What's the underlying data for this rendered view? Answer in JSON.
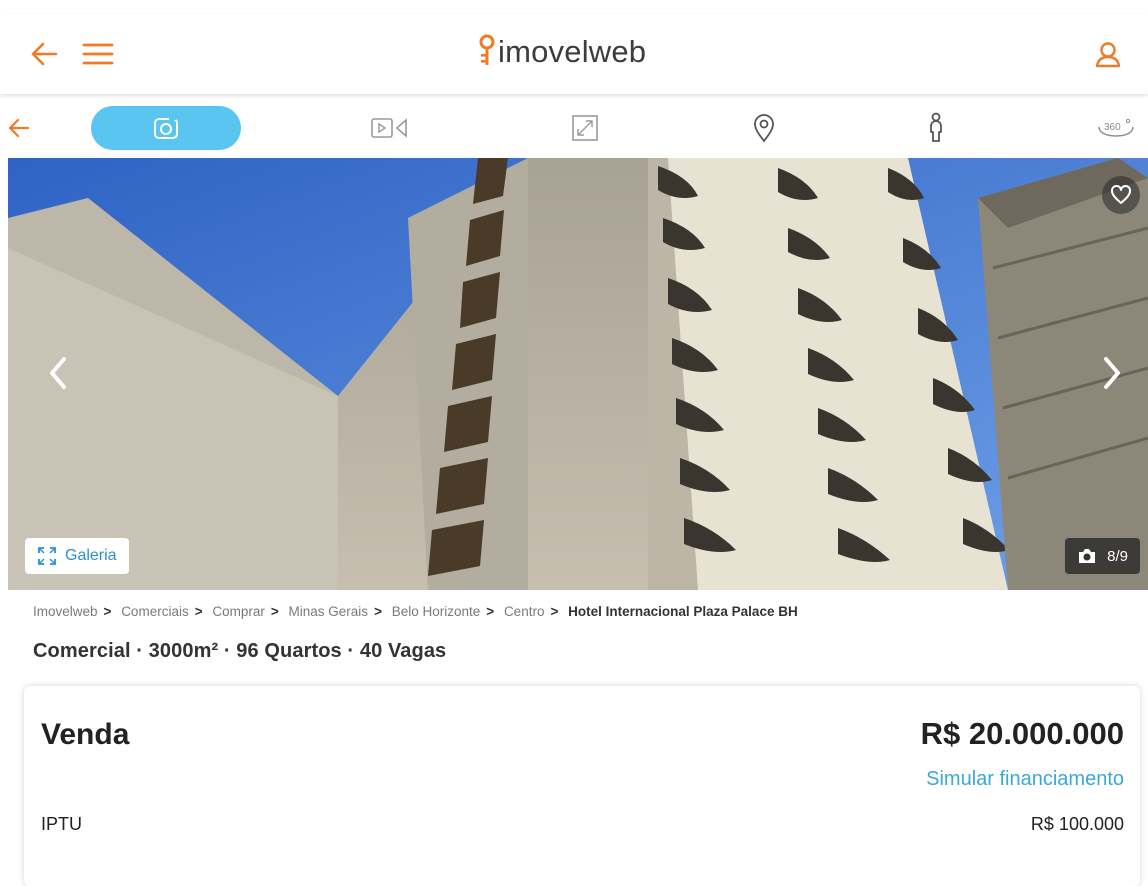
{
  "header": {
    "logo_text": "imovelweb",
    "accent_color": "#f07a25"
  },
  "media_tabs": [
    {
      "icon": "camera-icon",
      "active": true
    },
    {
      "icon": "video-icon",
      "active": false
    },
    {
      "icon": "floorplan-icon",
      "active": false
    },
    {
      "icon": "map-pin-icon",
      "active": false
    },
    {
      "icon": "street-view-icon",
      "active": false
    },
    {
      "icon": "360-view-icon",
      "active": false
    }
  ],
  "hero": {
    "gallery_label": "Galeria",
    "photo_counter": "8/9"
  },
  "breadcrumbs": [
    "Imovelweb",
    "Comerciais",
    "Comprar",
    "Minas Gerais",
    "Belo Horizonte",
    "Centro",
    "Hotel Internacional Plaza Palace BH"
  ],
  "subtitle": "Comercial · 3000m² · 96 Quartos · 40 Vagas",
  "price_card": {
    "operation": "Venda",
    "price": "R$ 20.000.000",
    "financing_link": "Simular financiamento",
    "iptu_label": "IPTU",
    "iptu_value": "R$ 100.000"
  }
}
